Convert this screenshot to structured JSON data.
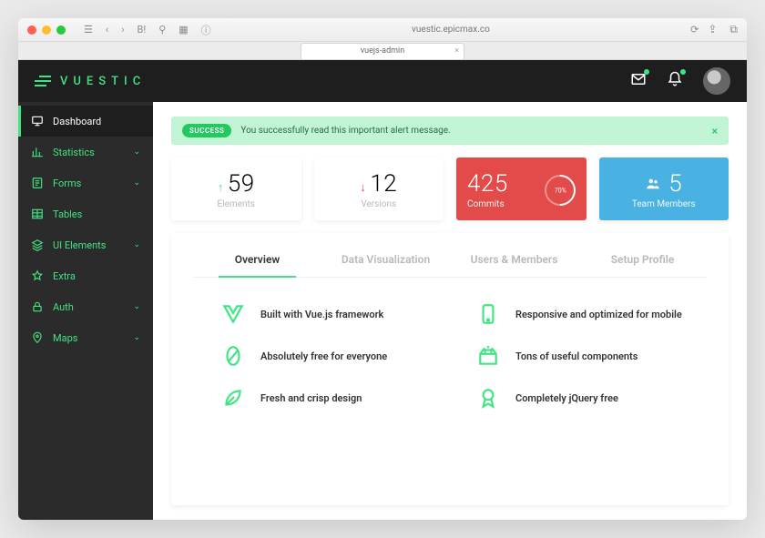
{
  "browser": {
    "url": "vuestic.epicmax.co",
    "tab_title": "vuejs-admin"
  },
  "brand": "VUESTIC",
  "sidebar": {
    "items": [
      {
        "label": "Dashboard"
      },
      {
        "label": "Statistics"
      },
      {
        "label": "Forms"
      },
      {
        "label": "Tables"
      },
      {
        "label": "UI Elements"
      },
      {
        "label": "Extra"
      },
      {
        "label": "Auth"
      },
      {
        "label": "Maps"
      }
    ]
  },
  "alert": {
    "badge": "SUCCESS",
    "text": "You successfully read this important alert message."
  },
  "stats": {
    "elements": {
      "value": "59",
      "label": "Elements",
      "trend": "up"
    },
    "versions": {
      "value": "12",
      "label": "Versions",
      "trend": "down"
    },
    "commits": {
      "value": "425",
      "label": "Commits",
      "pct": "70%"
    },
    "members": {
      "value": "5",
      "label": "Team Members"
    }
  },
  "tabs": [
    "Overview",
    "Data Visualization",
    "Users & Members",
    "Setup Profile"
  ],
  "features": [
    "Built with Vue.js framework",
    "Responsive and optimized for mobile",
    "Absolutely free for everyone",
    "Tons of useful components",
    "Fresh and crisp design",
    "Completely jQuery free"
  ]
}
